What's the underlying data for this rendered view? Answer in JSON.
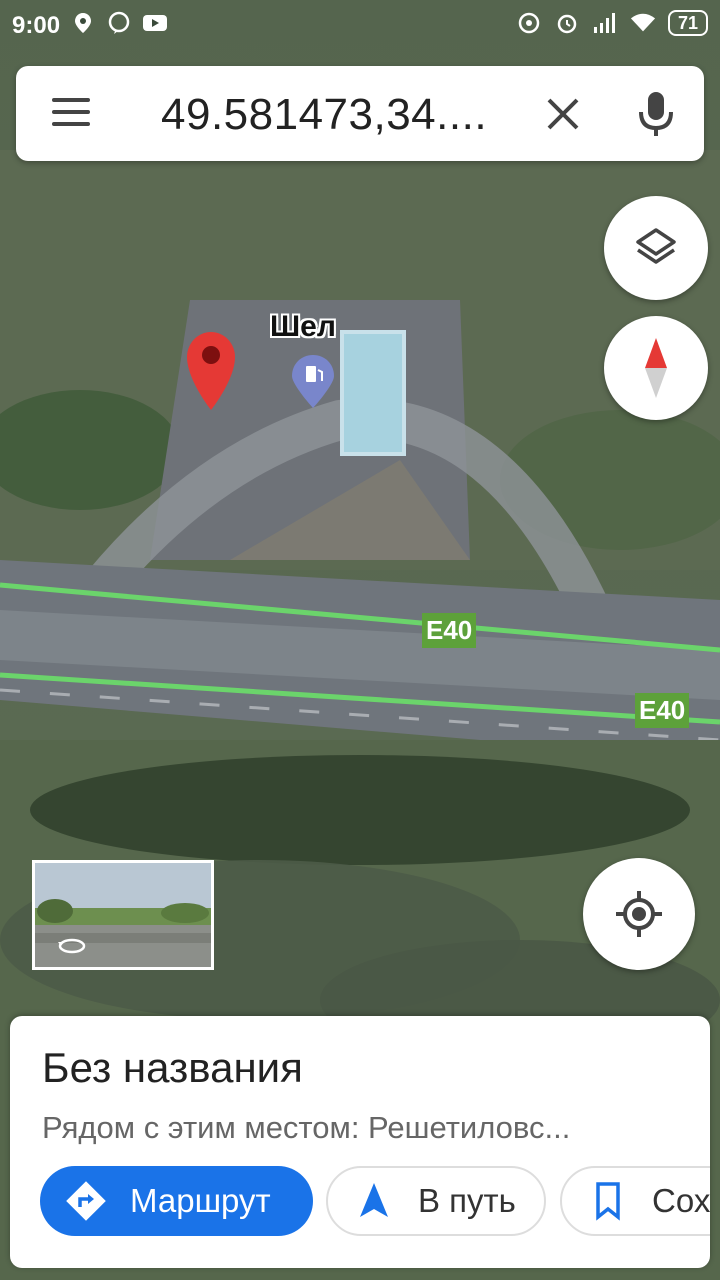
{
  "status_bar": {
    "time": "9:00",
    "battery": "71",
    "left_icons": [
      "maps-icon",
      "viber-icon",
      "youtube-icon"
    ],
    "right_icons": [
      "hotspot-icon",
      "alarm-icon",
      "signal-icon",
      "wifi-icon",
      "battery-icon"
    ]
  },
  "search": {
    "query": "49.581473,34....",
    "menu_icon": "menu-icon",
    "clear_icon": "close-icon",
    "mic_icon": "microphone-icon"
  },
  "map": {
    "poi_name": "Шел",
    "poi_icon": "gas-station-icon",
    "road_shield_1": "E40",
    "road_shield_2": "E40",
    "colors": {
      "road_green": "#6bd46b",
      "pin_red": "#e53935",
      "poi_blue": "#7986cb"
    }
  },
  "controls": {
    "layers_icon": "layers-icon",
    "compass_icon": "compass-icon",
    "location_icon": "my-location-icon"
  },
  "place_sheet": {
    "title": "Без названия",
    "subtitle": "Рядом с этим местом: Решетиловс...",
    "actions": [
      {
        "label": "Маршрут",
        "icon": "directions-icon"
      },
      {
        "label": "В путь",
        "icon": "navigation-icon"
      },
      {
        "label": "Сохр",
        "icon": "bookmark-icon"
      }
    ],
    "accent": "#1a73e8"
  }
}
